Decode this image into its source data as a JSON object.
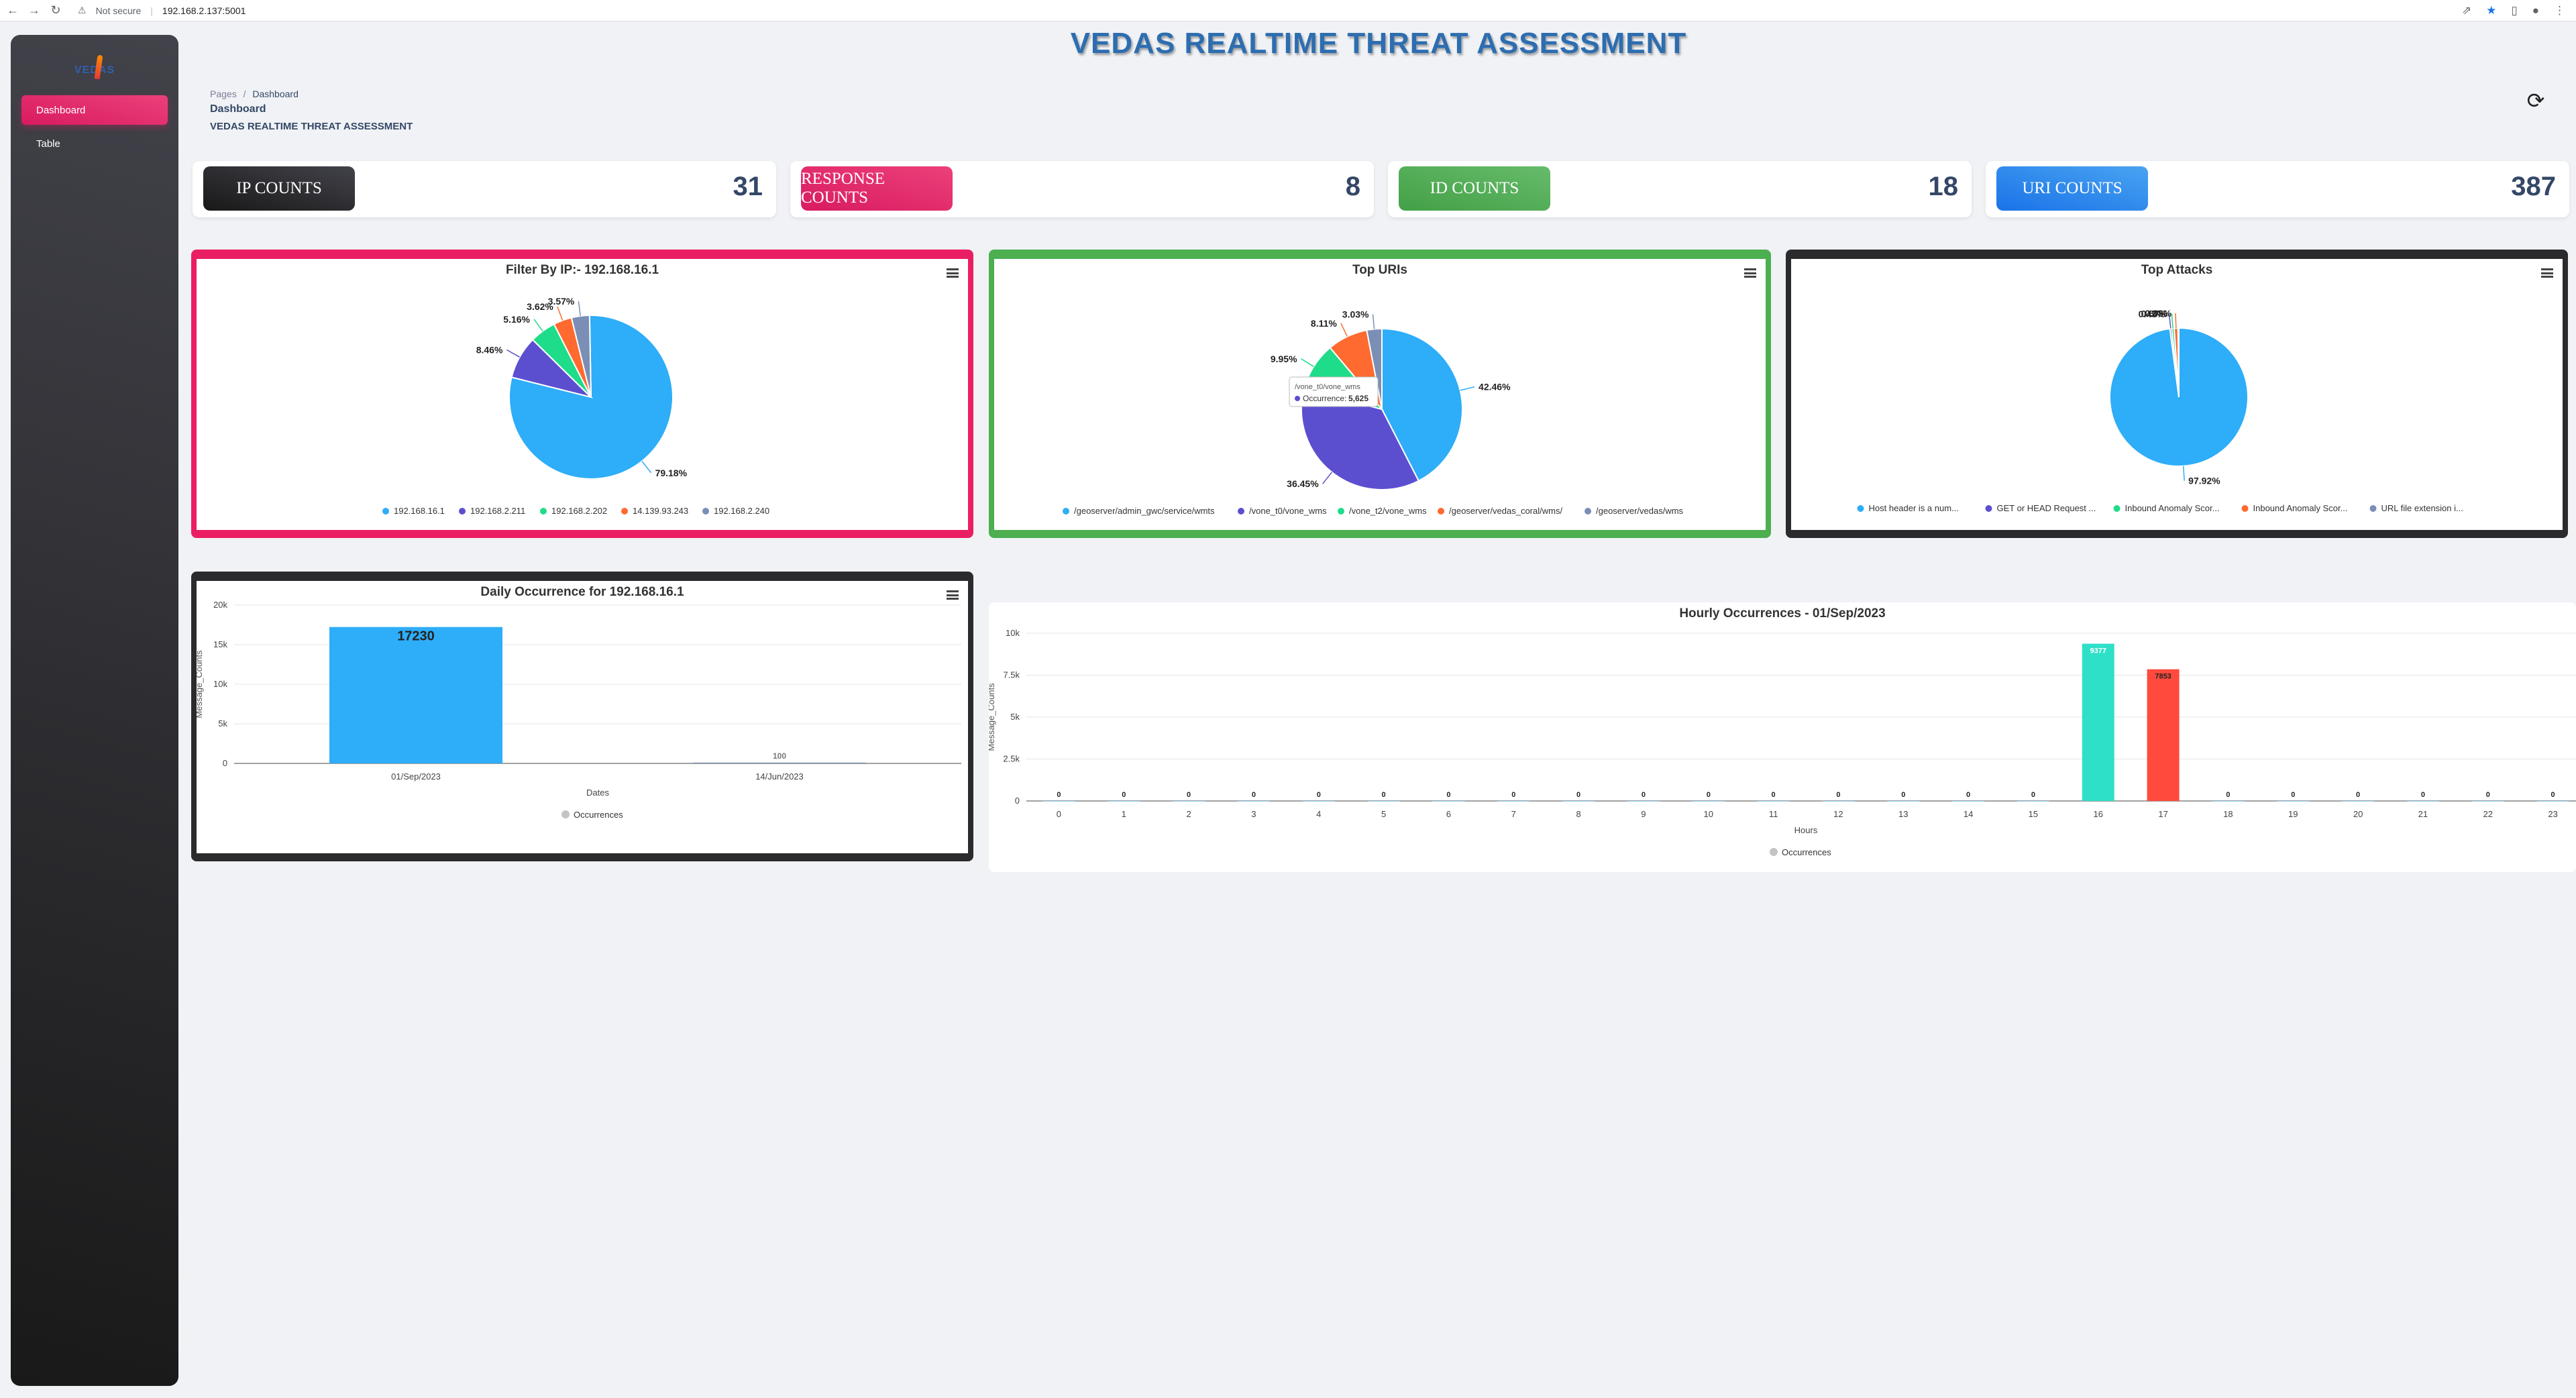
{
  "browser": {
    "security_label": "Not secure",
    "url": "192.168.2.137:5001"
  },
  "app_title": "VEDAS REALTIME THREAT ASSESSMENT",
  "sidebar": {
    "logo_text": "VEDAS",
    "items": [
      {
        "label": "Dashboard",
        "active": true
      },
      {
        "label": "Table",
        "active": false
      }
    ]
  },
  "breadcrumb": {
    "root": "Pages",
    "separator": "/",
    "current": "Dashboard",
    "title": "Dashboard",
    "subtitle": "VEDAS REALTIME THREAT ASSESSMENT"
  },
  "stats": [
    {
      "label": "IP COUNTS",
      "value": "31",
      "color": "#2b2b2e"
    },
    {
      "label": "RESPONSE COUNTS",
      "value": "8",
      "color": "#e91e63"
    },
    {
      "label": "ID COUNTS",
      "value": "18",
      "color": "#4caf50"
    },
    {
      "label": "URI COUNTS",
      "value": "387",
      "color": "#2196f3"
    }
  ],
  "colors": {
    "blue": "#2eadf8",
    "purple": "#5b4fcf",
    "green": "#1fdc8a",
    "orange": "#ff6a30",
    "slate": "#7b8eb5",
    "teal": "#2fe0c8",
    "red": "#ff4a3d",
    "grey": "#c4c4c4",
    "border_pink": "#e91e63",
    "border_green": "#4caf50",
    "border_dark": "#2b2b2e"
  },
  "chart_data": [
    {
      "type": "pie",
      "title": "Filter By IP:- 192.168.16.1",
      "labels": [
        "192.168.16.1",
        "192.168.2.211",
        "192.168.2.202",
        "14.139.93.243",
        "192.168.2.240"
      ],
      "values": [
        79.18,
        8.46,
        5.16,
        3.62,
        3.57
      ],
      "value_labels": [
        "79.18%",
        "8.46%",
        "5.16%",
        "3.62%",
        "3.57%"
      ],
      "legend": "bottom"
    },
    {
      "type": "pie",
      "title": "Top URIs",
      "labels": [
        "/geoserver/admin_gwc/service/wmts",
        "/vone_t0/vone_wms",
        "/vone_t2/vone_wms",
        "/geoserver/vedas_coral/wms/",
        "/geoserver/vedas/wms"
      ],
      "values": [
        42.46,
        36.45,
        9.95,
        8.11,
        3.03
      ],
      "value_labels": [
        "42.46%",
        "36.45%",
        "9.95%",
        "8.11%",
        "3.03%"
      ],
      "legend": "bottom",
      "tooltip": {
        "title": "/vone_t0/vone_wms",
        "label": "Occurrence:",
        "value": "5,625"
      }
    },
    {
      "type": "pie",
      "title": "Top Attacks",
      "labels": [
        "Host header is a num...",
        "GET or HEAD Request ...",
        "Inbound Anomaly Scor...",
        "Inbound Anomaly Scor...",
        "URL file extension i..."
      ],
      "values": [
        97.92,
        0.43,
        0.57,
        0.88,
        0.2
      ],
      "value_labels": [
        "97.92%",
        "0.43%",
        "0.57%",
        "0.88%"
      ],
      "legend": "bottom"
    },
    {
      "type": "bar",
      "title": "Daily Occurrence for 192.168.16.1",
      "categories": [
        "01/Sep/2023",
        "14/Jun/2023"
      ],
      "series": [
        {
          "name": "Occurrences",
          "values": [
            17230,
            100
          ]
        }
      ],
      "value_labels": [
        "17230",
        "100"
      ],
      "xlabel": "Dates",
      "ylabel": "Message_Counts",
      "ylim": [
        0,
        20000
      ],
      "yticks": [
        "0",
        "5k",
        "10k",
        "15k",
        "20k"
      ],
      "grid": true,
      "legend": "bottom"
    },
    {
      "type": "bar",
      "title": "Hourly Occurrences - 01/Sep/2023",
      "categories": [
        "0",
        "1",
        "2",
        "3",
        "4",
        "5",
        "6",
        "7",
        "8",
        "9",
        "10",
        "11",
        "12",
        "13",
        "14",
        "15",
        "16",
        "17",
        "18",
        "19",
        "20",
        "21",
        "22",
        "23"
      ],
      "series": [
        {
          "name": "Occurrences",
          "values": [
            0,
            0,
            0,
            0,
            0,
            0,
            0,
            0,
            0,
            0,
            0,
            0,
            0,
            0,
            0,
            0,
            9377,
            7853,
            0,
            0,
            0,
            0,
            0,
            0
          ]
        }
      ],
      "xlabel": "Hours",
      "ylabel": "Message_Counts",
      "ylim": [
        0,
        10000
      ],
      "yticks": [
        "0",
        "2.5k",
        "5k",
        "7.5k",
        "10k"
      ],
      "grid": true,
      "legend": "bottom"
    }
  ]
}
